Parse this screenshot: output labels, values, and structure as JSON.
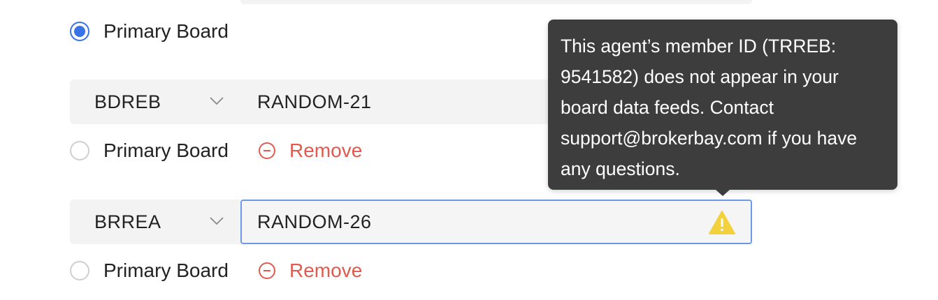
{
  "rows": [
    {
      "primary_label": "Primary Board",
      "primary_checked": true
    },
    {
      "board": "BDREB",
      "member_id": "RANDOM-21",
      "primary_label": "Primary Board",
      "remove_label": "Remove"
    },
    {
      "board": "BRREA",
      "member_id": "RANDOM-26",
      "primary_label": "Primary Board",
      "remove_label": "Remove"
    }
  ],
  "tooltip": {
    "text": "This agent’s member ID (TRREB: 9541582) does not appear in your board data feeds. Contact support@brokerbay.com if you have any questions."
  },
  "icons": {
    "warning": "warning-triangle-icon",
    "remove": "minus-circle-icon",
    "dropdown": "chevron-down-icon"
  },
  "colors": {
    "accent": "#3a73e8",
    "danger": "#e05a4f",
    "warning": "#f2d13d",
    "tooltip_bg": "#3d3d3d",
    "field_bg": "#f3f3f3"
  }
}
